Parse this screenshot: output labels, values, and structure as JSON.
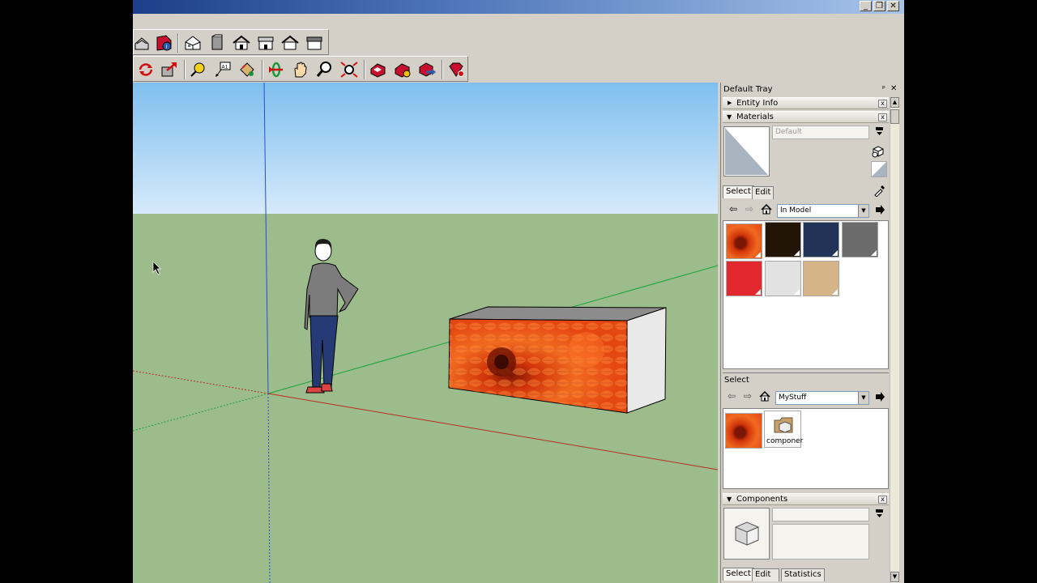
{
  "window": {
    "minimize": "_",
    "restore": "❐",
    "close": "✕"
  },
  "colors": {
    "sky_top": "#7fbfef",
    "sky_bottom": "#d6eafb",
    "ground": "#9dbc8c",
    "axis_blue": "#2b4bd6",
    "axis_green": "#16a33a",
    "axis_red": "#b52d1f",
    "box_top": "#8c8c8c",
    "box_side": "#e9e9e9"
  },
  "toolbar_top": {
    "icons": [
      "warehouse-icon",
      "info-icon",
      "iso-view-icon",
      "front-view-icon",
      "top-view-icon",
      "right-view-icon",
      "back-view-icon",
      "left-view-icon"
    ]
  },
  "toolbar_bottom": {
    "icons": [
      "rotate-icon",
      "push-pull-icon",
      "tape-measure-icon",
      "text-icon",
      "paint-bucket-icon",
      "orbit-icon",
      "pan-icon",
      "zoom-icon",
      "zoom-extents-icon",
      "share-model-icon",
      "components-icon",
      "upload-icon",
      "ruby-icon"
    ]
  },
  "tray": {
    "title": "Default Tray",
    "pin": "ᵖ",
    "close": "✕",
    "entity_info": {
      "label": "Entity Info",
      "close": "x"
    },
    "materials": {
      "label": "Materials",
      "close": "x",
      "name_placeholder": "Default",
      "tabs": [
        "Select",
        "Edit"
      ],
      "library": "In Model",
      "swatches": [
        {
          "name": "flower-texture",
          "color": "#e2491a"
        },
        {
          "name": "black-brown",
          "color": "#221508"
        },
        {
          "name": "navy-blue",
          "color": "#213458"
        },
        {
          "name": "gray",
          "color": "#6b6b6b"
        },
        {
          "name": "red",
          "color": "#e3282f"
        },
        {
          "name": "light-gray",
          "color": "#e2e2e2"
        },
        {
          "name": "tan",
          "color": "#d5b48a"
        }
      ],
      "select2_label": "Select",
      "library2": "MyStuff",
      "items": [
        {
          "name": "flower-texture",
          "label": ""
        },
        {
          "name": "components-folder",
          "label": "componer"
        }
      ]
    },
    "components": {
      "label": "Components",
      "close": "x",
      "tabs": [
        "Select",
        "Edit",
        "Statistics"
      ]
    }
  }
}
